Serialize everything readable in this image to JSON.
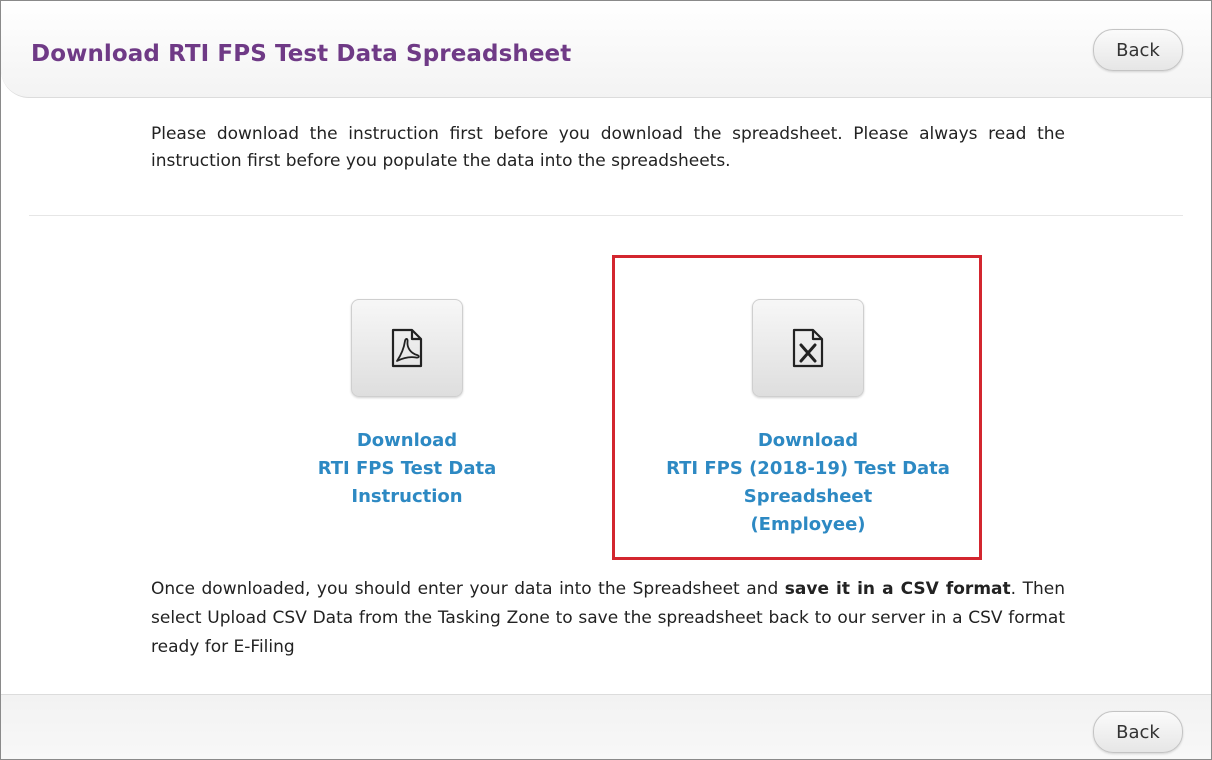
{
  "header": {
    "title": "Download RTI FPS Test Data Spreadsheet",
    "back_label": "Back"
  },
  "intro": "Please download the instruction first before you download the spreadsheet. Please always read the instruction first before you populate the data into the spreadsheets.",
  "downloads": [
    {
      "icon": "pdf-file-icon",
      "lines": [
        "Download",
        "RTI FPS Test Data",
        "Instruction"
      ]
    },
    {
      "icon": "excel-file-icon",
      "lines": [
        "Download",
        "RTI FPS (2018-19) Test Data",
        "Spreadsheet",
        "(Employee)"
      ],
      "highlight_color": "#d3262f"
    }
  ],
  "outro": {
    "before": "Once downloaded, you should enter your data into the Spreadsheet and ",
    "bold": "save it in a CSV format",
    "after": ". Then select Upload CSV Data from the Tasking Zone to save the spreadsheet back to our server in a CSV format ready for E-Filing"
  },
  "footer": {
    "back_label": "Back"
  },
  "colors": {
    "title": "#6f3a86",
    "link": "#2d89c3"
  }
}
